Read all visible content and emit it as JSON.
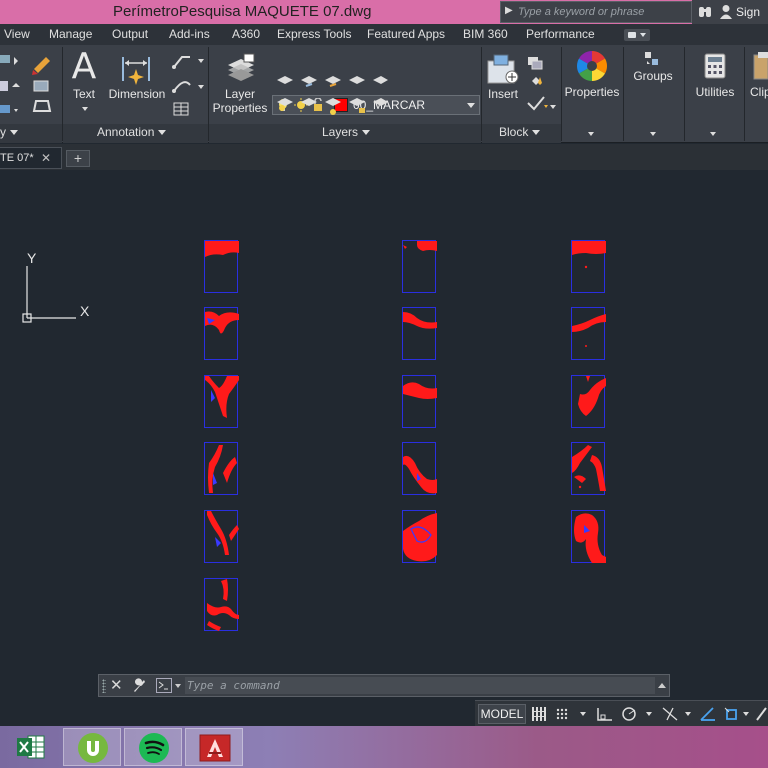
{
  "window": {
    "title": "PerímetroPesquisa MAQUETE 07.dwg",
    "search_placeholder": "Type a keyword or phrase",
    "sign_in": "Sign"
  },
  "ribbon_tabs": [
    "View",
    "Manage",
    "Output",
    "Add-ins",
    "A360",
    "Express Tools",
    "Featured Apps",
    "BIM 360",
    "Performance"
  ],
  "ribbon": {
    "annotation": {
      "title": "Annotation",
      "text_label": "Text",
      "dimension_label": "Dimension"
    },
    "layers": {
      "title": "Layers",
      "layer_properties_label": "Layer\nProperties",
      "current_layer": "00_MARCAR",
      "current_layer_color": "#ff0000"
    },
    "block": {
      "title": "Block",
      "insert_label": "Insert"
    },
    "properties": {
      "label": "Properties"
    },
    "groups": {
      "label": "Groups"
    },
    "utilities": {
      "label": "Utilities"
    },
    "clipboard": {
      "label": "Clip"
    }
  },
  "file_tab": {
    "label": "TE 07*",
    "close": "✕",
    "new_tab": "+"
  },
  "ucs": {
    "x_label": "X",
    "y_label": "Y"
  },
  "colors": {
    "tile_border": "#2a2fe0",
    "tile_fill": "#ff0000",
    "canvas_bg": "#212830"
  },
  "command_line": {
    "placeholder": "Type a command"
  },
  "status_bar": {
    "model": "MODEL"
  },
  "taskbar": {
    "apps": [
      "excel-icon",
      "utorrent-icon",
      "spotify-icon",
      "autocad-icon"
    ]
  }
}
